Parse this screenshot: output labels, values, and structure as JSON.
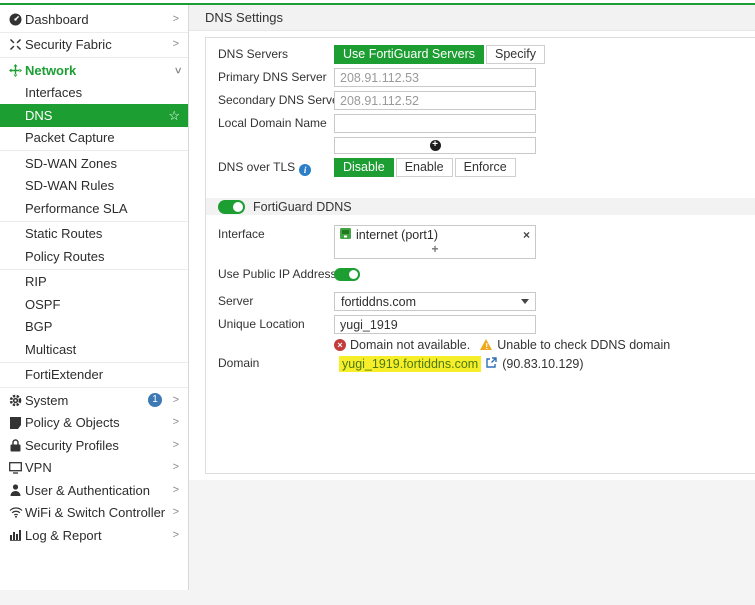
{
  "glyphs": {
    "chevron_right": ">",
    "star": "☆",
    "plus": "+",
    "close": "×",
    "info_i": "i",
    "exclaim": "!"
  },
  "colors": {
    "accent_green": "#1d9e33",
    "badge_blue": "#3d7ab5",
    "error_red": "#c33c3c",
    "warning_orange": "#f0a91e",
    "highlight_yellow": "#f7ee2a"
  },
  "sidebar": {
    "items": [
      {
        "label": "Dashboard",
        "icon": "gauge-icon"
      },
      {
        "label": "Security Fabric",
        "icon": "fabric-icon"
      },
      {
        "label": "Network",
        "icon": "network-icon",
        "expanded": true
      },
      {
        "label": "Interfaces"
      },
      {
        "label": "DNS",
        "active": true,
        "starred": true
      },
      {
        "label": "Packet Capture"
      },
      {
        "label": "SD-WAN Zones"
      },
      {
        "label": "SD-WAN Rules"
      },
      {
        "label": "Performance SLA"
      },
      {
        "label": "Static Routes"
      },
      {
        "label": "Policy Routes"
      },
      {
        "label": "RIP"
      },
      {
        "label": "OSPF"
      },
      {
        "label": "BGP"
      },
      {
        "label": "Multicast"
      },
      {
        "label": "FortiExtender"
      },
      {
        "label": "System",
        "icon": "gear-icon",
        "badge": "1"
      },
      {
        "label": "Policy & Objects",
        "icon": "policy-icon"
      },
      {
        "label": "Security Profiles",
        "icon": "lock-icon"
      },
      {
        "label": "VPN",
        "icon": "monitor-icon"
      },
      {
        "label": "User & Authentication",
        "icon": "user-icon"
      },
      {
        "label": "WiFi & Switch Controller",
        "icon": "wifi-icon"
      },
      {
        "label": "Log & Report",
        "icon": "chart-icon"
      }
    ]
  },
  "header": {
    "title": "DNS Settings"
  },
  "dns": {
    "servers_label": "DNS Servers",
    "servers_options": [
      "Use FortiGuard Servers",
      "Specify"
    ],
    "servers_selected": "Use FortiGuard Servers",
    "primary_label": "Primary DNS Server",
    "primary_value": "208.91.112.53",
    "secondary_label": "Secondary DNS Server",
    "secondary_value": "208.91.112.52",
    "local_domain_label": "Local Domain Name",
    "local_domain_value": "",
    "tls_label": "DNS over TLS",
    "tls_options": [
      "Disable",
      "Enable",
      "Enforce"
    ],
    "tls_selected": "Disable"
  },
  "ddns": {
    "title": "FortiGuard DDNS",
    "enabled": true,
    "interface_label": "Interface",
    "interface_value": "internet (port1)",
    "use_public_ip_label": "Use Public IP Address",
    "use_public_ip_on": true,
    "server_label": "Server",
    "server_value": "fortiddns.com",
    "unique_location_label": "Unique Location",
    "unique_location_value": "yugi_1919",
    "error_text": "Domain not available.",
    "warning_text": "Unable to check DDNS domain",
    "domain_label": "Domain",
    "domain_link": "yugi_1919.fortiddns.com",
    "domain_ip": "(90.83.10.129)"
  }
}
